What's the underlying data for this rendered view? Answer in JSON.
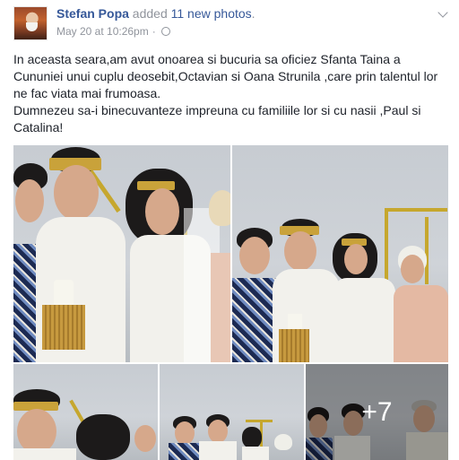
{
  "post": {
    "author": "Stefan Popa",
    "action_prefix": "added",
    "photo_count": "11 new photos",
    "action_suffix": ".",
    "timestamp": "May 20 at 10:26pm",
    "separator": "·",
    "privacy_icon": "public-globe-icon",
    "menu_icon": "chevron-down-icon"
  },
  "message": {
    "line1": "In aceasta seara,am avut onoarea si bucuria sa oficiez Sfanta Taina a Cununiei unui cuplu deosebit,Octavian si Oana Strunila ,care prin talentul lor ne fac viata mai frumoasa.",
    "line2": "Dumnezeu sa-i binecuvanteze impreuna cu familiile lor si cu nasii ,Paul si Catalina!"
  },
  "gallery": {
    "more_label": "+7"
  },
  "colors": {
    "link": "#365899",
    "meta": "#90949c",
    "text": "#1d2129"
  }
}
